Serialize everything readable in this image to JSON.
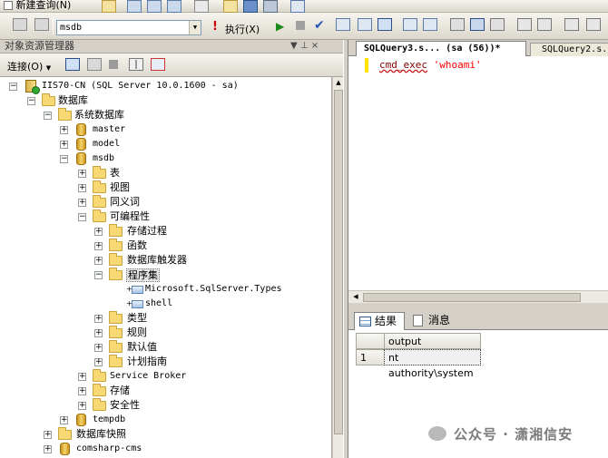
{
  "toolbar": {
    "new_query_label": "新建查询(N)",
    "database_value": "msdb",
    "execute_label": "执行(X)"
  },
  "object_explorer": {
    "title": "对象资源管理器",
    "pin_symbol": "▼ ⊥ ×",
    "connect_label": "连接(O)"
  },
  "tree": {
    "server": "IIS70-CN (SQL Server 10.0.1600 - sa)",
    "databases": "数据库",
    "system_databases": "系统数据库",
    "master": "master",
    "model": "model",
    "msdb": "msdb",
    "tables": "表",
    "views": "视图",
    "synonyms": "同义词",
    "programmability": "可编程性",
    "stored_procedures": "存储过程",
    "functions": "函数",
    "db_triggers": "数据库触发器",
    "assemblies": "程序集",
    "assembly_1": "Microsoft.SqlServer.Types",
    "assembly_2": "shell",
    "types": "类型",
    "rules": "规则",
    "defaults": "默认值",
    "plan_guides": "计划指南",
    "service_broker": "Service Broker",
    "storage": "存储",
    "security": "安全性",
    "tempdb": "tempdb",
    "db_snapshots": "数据库快照",
    "comsharp": "comsharp-cms"
  },
  "editor": {
    "active_tab": "SQLQuery3.s... (sa (56))*",
    "inactive_tab": "SQLQuery2.s...",
    "code_keyword": "cmd_exec",
    "code_string": "'whoami'"
  },
  "results": {
    "tab_results": "结果",
    "tab_messages": "消息",
    "column": "output",
    "row_num": "1",
    "row_value": "nt authority\\system"
  },
  "watermark": {
    "text": "公众号 · 潇湘信安"
  }
}
